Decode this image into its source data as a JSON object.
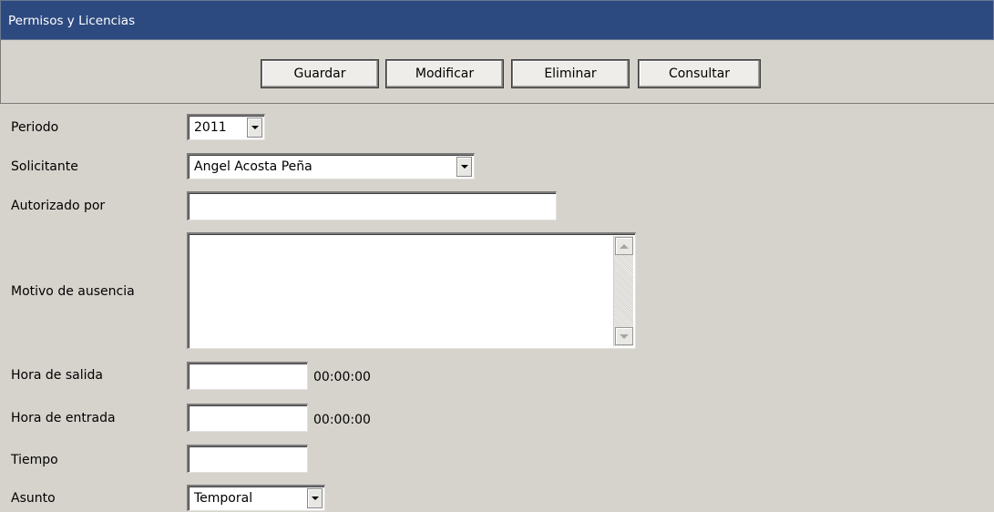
{
  "window": {
    "title": "Permisos y Licencias"
  },
  "toolbar": {
    "guardar": "Guardar",
    "modificar": "Modificar",
    "eliminar": "Eliminar",
    "consultar": "Consultar"
  },
  "form": {
    "periodo": {
      "label": "Periodo",
      "value": "2011"
    },
    "solicitante": {
      "label": "Solicitante",
      "value": "Angel Acosta Peña"
    },
    "autorizado": {
      "label": "Autorizado por",
      "value": ""
    },
    "motivo": {
      "label": "Motivo de ausencia",
      "value": ""
    },
    "hora_salida": {
      "label": "Hora de salida",
      "value": "",
      "display": "00:00:00"
    },
    "hora_entrada": {
      "label": "Hora de entrada",
      "value": "",
      "display": "00:00:00"
    },
    "tiempo": {
      "label": "Tiempo",
      "value": ""
    },
    "asunto": {
      "label": "Asunto",
      "value": "Temporal"
    }
  },
  "icons": {
    "dropdown": "chevron-down-icon",
    "scroll_up": "scroll-up-icon",
    "scroll_down": "scroll-down-icon"
  },
  "colors": {
    "titlebar_bg": "#2d4a80",
    "window_bg": "#d6d2cc",
    "field_bg": "#ffffff"
  }
}
